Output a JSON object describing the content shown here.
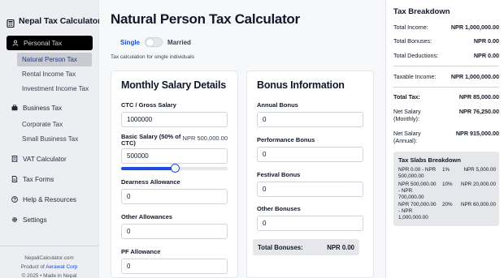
{
  "app": {
    "name": "Nepal Tax Calculator"
  },
  "sidebar": {
    "items": [
      {
        "label": "Personal Tax",
        "icon": "user-icon"
      },
      {
        "label": "Natural Person Tax"
      },
      {
        "label": "Rental Income Tax"
      },
      {
        "label": "Investment Income Tax"
      },
      {
        "label": "Business Tax",
        "icon": "briefcase-icon"
      },
      {
        "label": "Corporate Tax"
      },
      {
        "label": "Small Business Tax"
      },
      {
        "label": "VAT Calculator",
        "icon": "receipt-icon"
      },
      {
        "label": "Tax Forms",
        "icon": "document-icon"
      },
      {
        "label": "Help & Resources",
        "icon": "help-icon"
      },
      {
        "label": "Settings",
        "icon": "gear-icon"
      }
    ],
    "footer": {
      "site": "NepaliCalculator.com",
      "product_prefix": "Product of ",
      "company": "Aerawat Corp",
      "copyright": "© 2025 • Made in Nepal"
    }
  },
  "main": {
    "title": "Natural Person Tax Calculator",
    "toggle": {
      "left": "Single",
      "right": "Married",
      "on": false
    },
    "subtitle": "Tax calculation for single individuals",
    "salary": {
      "heading": "Monthly Salary Details",
      "ctc_label": "CTC / Gross Salary",
      "ctc_value": "1000000",
      "basic_label": "Basic Salary (50% of CTC)",
      "basic_aside": "NPR 500,000.00",
      "basic_value": "500000",
      "basic_ratio": 0.5,
      "dearness_label": "Dearness Allowance",
      "dearness_value": "0",
      "other_allow_label": "Other Allowances",
      "other_allow_value": "0",
      "pf_label": "PF Allowance",
      "pf_value": "0"
    },
    "bonus": {
      "heading": "Bonus Information",
      "annual_label": "Annual Bonus",
      "annual_value": "0",
      "performance_label": "Performance Bonus",
      "performance_value": "0",
      "festival_label": "Festival Bonus",
      "festival_value": "0",
      "other_label": "Other Bonuses",
      "other_value": "0",
      "total_label": "Total Bonuses:",
      "total_value": "NPR 0.00"
    }
  },
  "breakdown": {
    "heading": "Tax Breakdown",
    "total_income_label": "Total Income:",
    "total_income": "NPR 1,000,000.00",
    "total_bonuses_label": "Total Bonuses:",
    "total_bonuses": "NPR 0.00",
    "total_deductions_label": "Total Deductions:",
    "total_deductions": "NPR 0.00",
    "taxable_label": "Taxable Income:",
    "taxable": "NPR 1,000,000.00",
    "total_tax_label": "Total Tax:",
    "total_tax": "NPR 85,000.00",
    "net_monthly_label": "Net Salary (Monthly):",
    "net_monthly": "NPR 76,250.00",
    "net_annual_label": "Net Salary (Annual):",
    "net_annual": "NPR 915,000.00",
    "slabs_heading": "Tax Slabs Breakdown",
    "slabs": [
      {
        "range": "NPR 0.00 - NPR 500,000.00",
        "rate": "1%",
        "tax": "NPR 5,000.00"
      },
      {
        "range": "NPR 500,000.00 - NPR 700,000.00",
        "rate": "10%",
        "tax": "NPR 20,000.00"
      },
      {
        "range": "NPR 700,000.00 - NPR 1,000,000.00",
        "rate": "20%",
        "tax": "NPR 60,000.00"
      }
    ]
  },
  "colors": {
    "accent": "#1d4ed8",
    "sidebar_active": "#000000",
    "sub_active_bg": "#c8cbd2"
  }
}
